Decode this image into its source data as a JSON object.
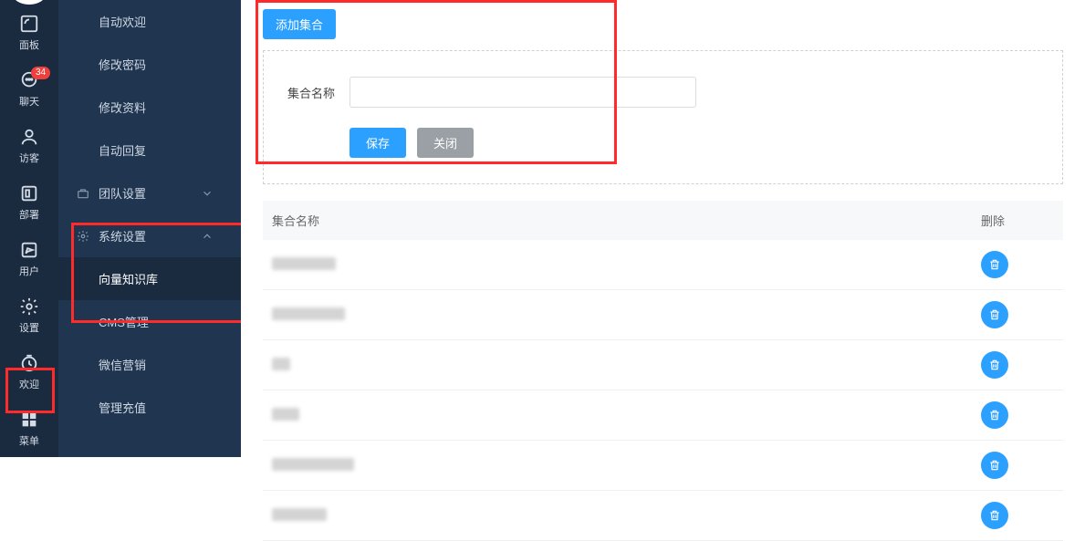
{
  "rail": {
    "items": [
      {
        "name": "panel",
        "label": "面板",
        "badge": null
      },
      {
        "name": "chat",
        "label": "聊天",
        "badge": "34"
      },
      {
        "name": "visitor",
        "label": "访客",
        "badge": null
      },
      {
        "name": "deploy",
        "label": "部署",
        "badge": null
      },
      {
        "name": "user",
        "label": "用户",
        "badge": null
      },
      {
        "name": "setting",
        "label": "设置",
        "badge": null
      },
      {
        "name": "welcome",
        "label": "欢迎",
        "badge": null
      },
      {
        "name": "menu",
        "label": "菜单",
        "badge": null
      }
    ]
  },
  "menu2": {
    "top_items": [
      {
        "label": "自动欢迎"
      },
      {
        "label": "修改密码"
      },
      {
        "label": "修改资料"
      },
      {
        "label": "自动回复"
      }
    ],
    "group_team": {
      "label": "团队设置"
    },
    "group_system": {
      "label": "系统设置"
    },
    "system_children": [
      {
        "label": "向量知识库",
        "active": true
      },
      {
        "label": "CMS管理"
      },
      {
        "label": "微信营销"
      },
      {
        "label": "管理充值"
      }
    ]
  },
  "main": {
    "add_label": "添加集合",
    "form": {
      "name_label": "集合名称",
      "save_label": "保存",
      "close_label": "关闭"
    },
    "table": {
      "head_name": "集合名称",
      "head_delete": "删除",
      "rows_count": 6
    }
  }
}
